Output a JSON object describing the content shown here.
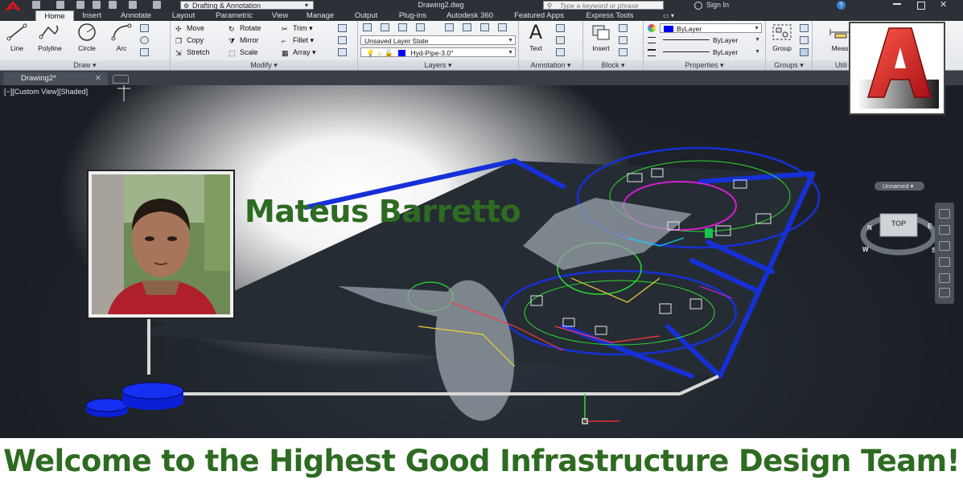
{
  "titlebar": {
    "workspace": "Drafting & Annotation",
    "document_title": "Drawing2.dwg",
    "search_placeholder": "Type a keyword or phrase",
    "sign_in": "Sign In"
  },
  "tabs": [
    "Home",
    "Insert",
    "Annotate",
    "Layout",
    "Parametric",
    "View",
    "Manage",
    "Output",
    "Plug-ins",
    "Autodesk 360",
    "Featured Apps",
    "Express Tools"
  ],
  "active_tab": "Home",
  "ribbon": {
    "draw": {
      "title": "Draw",
      "tools": [
        "Line",
        "Polyline",
        "Circle",
        "Arc"
      ]
    },
    "modify": {
      "title": "Modify",
      "tools": [
        "Move",
        "Rotate",
        "Trim",
        "Copy",
        "Mirror",
        "Fillet",
        "Stretch",
        "Scale",
        "Array"
      ]
    },
    "layers": {
      "title": "Layers",
      "layer_state": "Unsaved Layer State",
      "current_layer": "Hyd-Pipe-3.0''"
    },
    "annotation": {
      "title": "Annotation",
      "text_label": "Text"
    },
    "block": {
      "title": "Block",
      "insert_label": "Insert"
    },
    "properties": {
      "title": "Properties",
      "color": "ByLayer",
      "linetype": "ByLayer",
      "lineweight": "ByLayer"
    },
    "groups": {
      "title": "Groups",
      "group_label": "Group"
    },
    "utilities": {
      "title": "Utili",
      "measure_label": "Meas"
    }
  },
  "file_tab": "Drawing2*",
  "viewport": {
    "view_label": "[−][Custom View][Shaded]",
    "viewcube_face": "TOP",
    "compass": {
      "n": "N",
      "e": "E",
      "s": "S",
      "w": "W"
    },
    "ucs_name": "Unnamed"
  },
  "overlay": {
    "name": "Mateus Barretto",
    "welcome": "Welcome to the Highest Good Infrastructure Design Team!"
  },
  "colors": {
    "accent_green": "#2e6b22",
    "viewport_bg": "#1b1f25",
    "pipe_blue": "#1020c8",
    "tank_blue": "#0b1fd6"
  },
  "icons": [
    "autocad-app-icon",
    "search-icon",
    "user-icon",
    "help-icon",
    "autocad-logo-icon"
  ]
}
